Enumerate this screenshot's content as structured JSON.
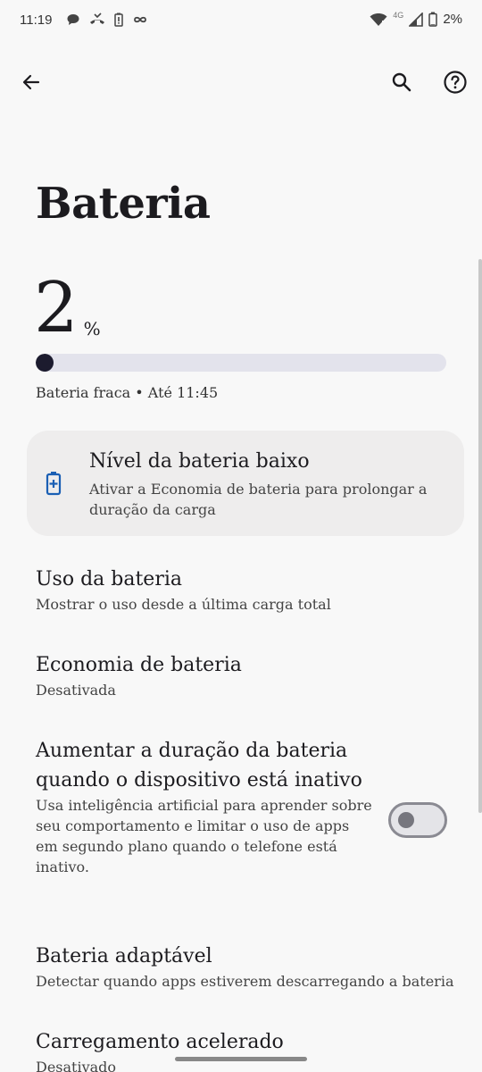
{
  "status_bar": {
    "time": "11:19",
    "network_type": "4G",
    "battery_percent": "2%"
  },
  "page": {
    "title": "Bateria"
  },
  "battery": {
    "level": "2",
    "unit": "%",
    "level_fraction": 0.02,
    "status": "Bateria fraca • Até 11:45"
  },
  "tip_card": {
    "icon": "battery-saver-icon",
    "title": "Nível da bateria baixo",
    "description": "Ativar a Economia de bateria para prolongar a duração da carga"
  },
  "settings": [
    {
      "title": "Uso da bateria",
      "summary": "Mostrar o uso desde a última carga total"
    },
    {
      "title": "Economia de bateria",
      "summary": "Desativada"
    },
    {
      "title": "Aumentar a duração da bateria quando o dispositivo está inativo",
      "summary": "Usa inteligência artificial para aprender sobre seu comportamento e limitar o uso de apps em segundo plano quando o telefone está inativo.",
      "toggle_on": false
    },
    {
      "title": "Bateria adaptável",
      "summary": "Detectar quando apps estiverem descarregando a bateria"
    },
    {
      "title": "Carregamento acelerado",
      "summary": "Desativado"
    }
  ],
  "colors": {
    "background": "#f8f8f8",
    "progress_fill": "#1c1b2e",
    "progress_track": "#e3e3ec",
    "card": "#eeeded",
    "accent_icon": "#1a5fb4"
  }
}
